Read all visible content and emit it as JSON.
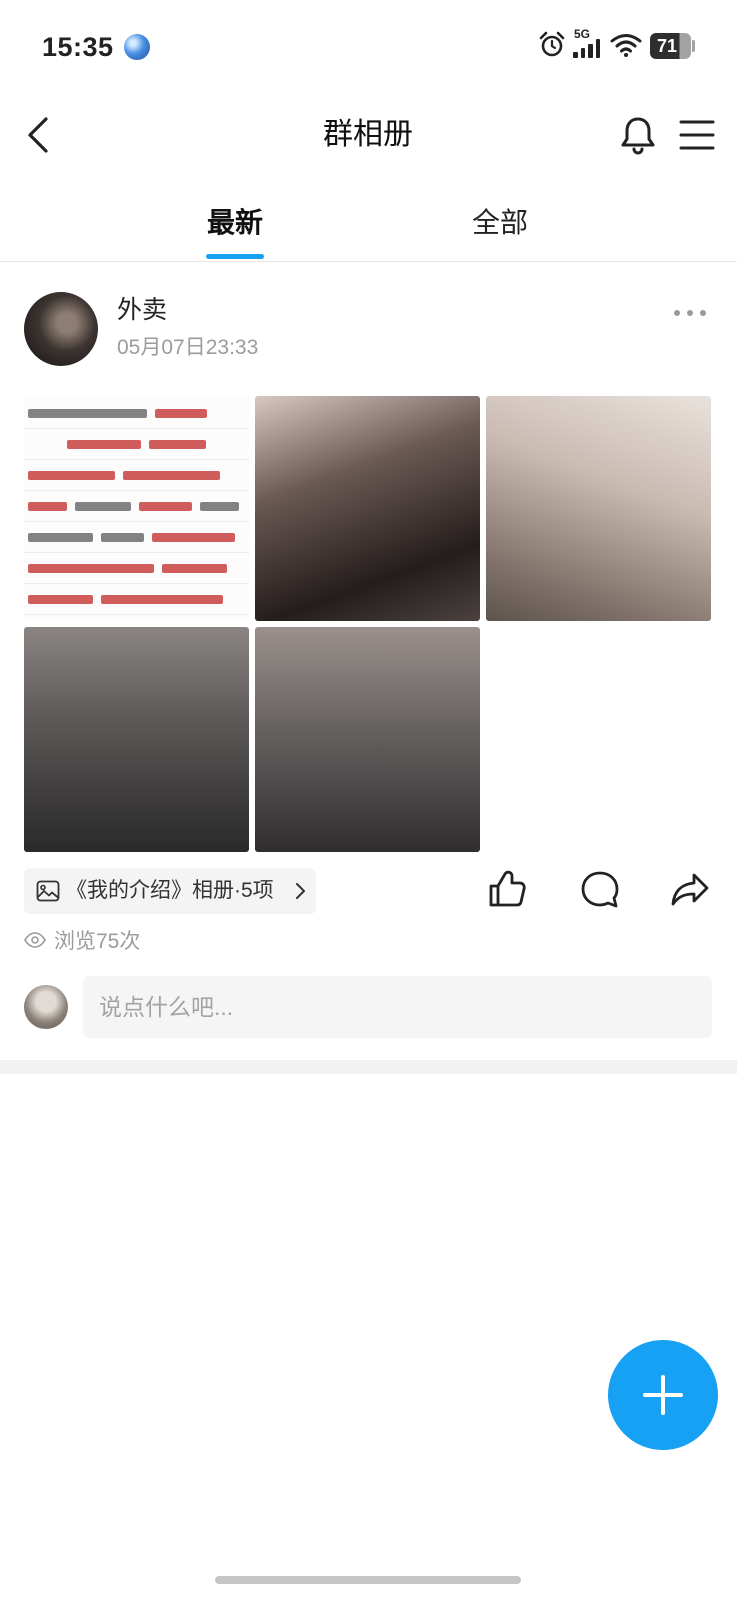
{
  "status_bar": {
    "time": "15:35",
    "network": "5G",
    "battery": "71",
    "icons": [
      "globe-icon",
      "alarm-icon",
      "signal-icon",
      "wifi-icon",
      "battery-icon"
    ]
  },
  "header": {
    "title": "群相册",
    "icons": {
      "left": "back-icon",
      "right": [
        "bell-icon",
        "menu-icon"
      ]
    }
  },
  "tabs": [
    {
      "label": "最新",
      "active": true
    },
    {
      "label": "全部",
      "active": false
    }
  ],
  "post": {
    "author": "外卖",
    "timestamp": "05月07日23:33",
    "album_chip": {
      "label": "《我的介绍》相册·5项",
      "icon": "image-icon"
    },
    "actions": [
      "like-icon",
      "comment-icon",
      "share-icon"
    ],
    "views": "浏览75次",
    "comment_input": {
      "placeholder": "说点什么吧..."
    }
  },
  "fab": {
    "icon": "plus-icon"
  },
  "colors": {
    "accent": "#16a1f4",
    "secondary_text": "#9b9b9b"
  }
}
